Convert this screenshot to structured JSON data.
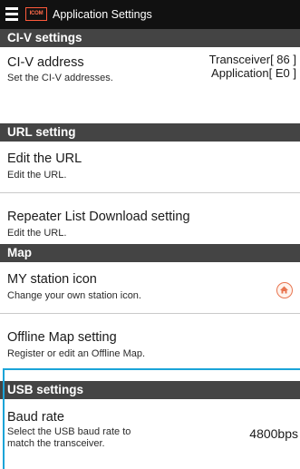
{
  "app": {
    "title": "Application Settings",
    "logo_text": "ICOM"
  },
  "colors": {
    "appbar": "#111111",
    "section_header": "#444444",
    "highlight": "#1ba4d8",
    "icon_accent": "#e8744f"
  },
  "sections": {
    "civ": {
      "header": "CI-V settings",
      "address": {
        "title": "CI-V address",
        "subtitle": "Set the CI-V addresses.",
        "value_line1": "Transceiver[ 86 ]",
        "value_line2": "Application[ E0 ]"
      }
    },
    "url": {
      "header": "URL setting",
      "edit_url": {
        "title": "Edit the URL",
        "subtitle": "Edit the URL."
      },
      "repeater": {
        "title": "Repeater List Download setting",
        "subtitle": "Edit the URL."
      }
    },
    "map": {
      "header": "Map",
      "my_station": {
        "title": "MY station icon",
        "subtitle": "Change your own station icon.",
        "icon": "home-icon"
      },
      "offline": {
        "title": "Offline Map setting",
        "subtitle": "Register or edit an Offline Map."
      }
    },
    "usb": {
      "header": "USB settings",
      "baud": {
        "title": "Baud rate",
        "subtitle_line1": "Select the USB baud rate to",
        "subtitle_line2": "match the transceiver.",
        "value": "4800bps"
      }
    }
  }
}
